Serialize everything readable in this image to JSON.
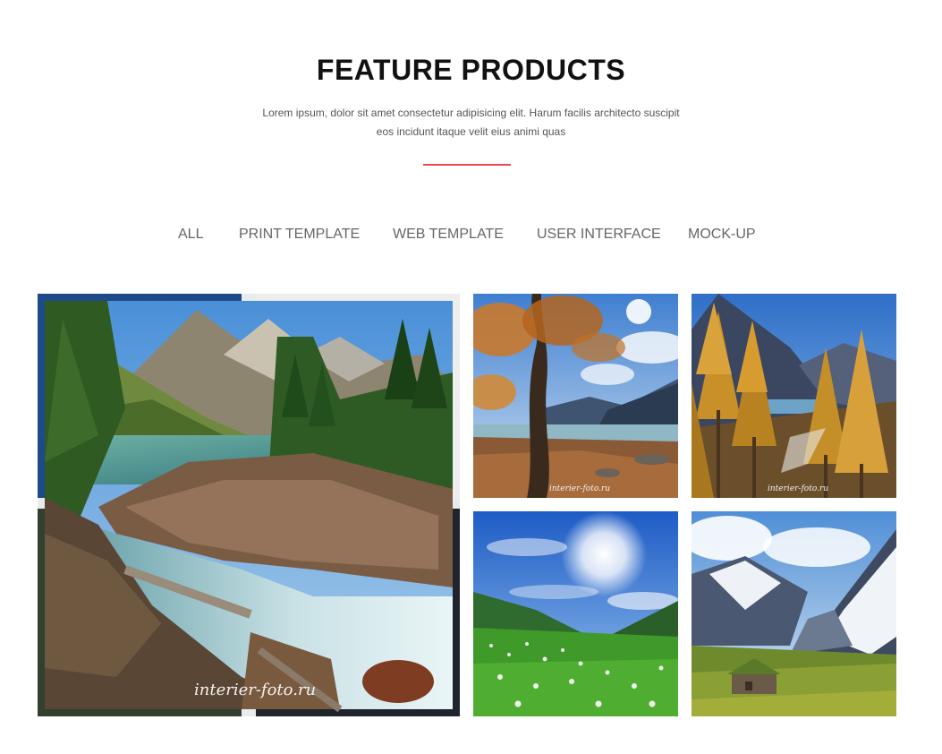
{
  "header": {
    "title": "FEATURE PRODUCTS",
    "subtitle": "Lorem ipsum, dolor sit amet consectetur adipisicing elit. Harum facilis architecto suscipit eos incidunt itaque velit eius animi quas"
  },
  "filters": [
    {
      "label": "ALL"
    },
    {
      "label": "PRINT TEMPLATE"
    },
    {
      "label": "WEB TEMPLATE"
    },
    {
      "label": "USER INTERFACE"
    },
    {
      "label": "MOCK-UP"
    }
  ],
  "gallery": {
    "items": [
      {
        "name": "mountain-river-photo",
        "watermark": "interier-foto.ru"
      },
      {
        "name": "autumn-tree-lake-photo",
        "watermark": "interier-foto.ru"
      },
      {
        "name": "golden-larch-forest-photo",
        "watermark": "interier-foto.ru"
      },
      {
        "name": "sunny-meadow-photo"
      },
      {
        "name": "alpine-valley-hut-photo"
      }
    ]
  },
  "colors": {
    "accent": "#e84a4a",
    "title": "#111111",
    "text": "#555555",
    "filter": "#666666"
  }
}
